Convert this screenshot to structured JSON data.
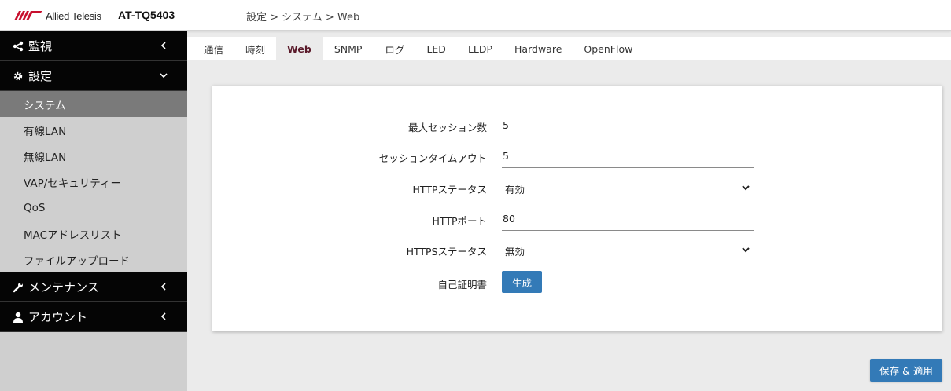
{
  "header": {
    "brand": "Allied Telesis",
    "model": "AT-TQ5403",
    "breadcrumb": "設定 > システム > Web"
  },
  "sidebar": {
    "groups": [
      {
        "label": "監視",
        "icon": "share-icon",
        "state": "collapsed"
      },
      {
        "label": "設定",
        "icon": "gear-icon",
        "state": "expanded"
      },
      {
        "label": "メンテナンス",
        "icon": "wrench-icon",
        "state": "collapsed"
      },
      {
        "label": "アカウント",
        "icon": "user-icon",
        "state": "collapsed"
      }
    ],
    "items": [
      {
        "label": "システム",
        "active": true
      },
      {
        "label": "有線LAN"
      },
      {
        "label": "無線LAN"
      },
      {
        "label": "VAP/セキュリティー"
      },
      {
        "label": "QoS"
      },
      {
        "label": "MACアドレスリスト"
      },
      {
        "label": "ファイルアップロード"
      }
    ]
  },
  "tabs": [
    {
      "label": "通信"
    },
    {
      "label": "時刻"
    },
    {
      "label": "Web",
      "active": true
    },
    {
      "label": "SNMP"
    },
    {
      "label": "ログ"
    },
    {
      "label": "LED"
    },
    {
      "label": "LLDP"
    },
    {
      "label": "Hardware"
    },
    {
      "label": "OpenFlow"
    }
  ],
  "form": {
    "max_sessions": {
      "label": "最大セッション数",
      "value": "5"
    },
    "session_timeout": {
      "label": "セッションタイムアウト",
      "value": "5"
    },
    "http_status": {
      "label": "HTTPステータス",
      "value": "有効"
    },
    "http_port": {
      "label": "HTTPポート",
      "value": "80"
    },
    "https_status": {
      "label": "HTTPSステータス",
      "value": "無効"
    },
    "self_cert": {
      "label": "自己証明書",
      "button": "生成"
    }
  },
  "actions": {
    "save_label": "保存 & 適用"
  },
  "colors": {
    "accent": "#337ab7",
    "nav_dark": "#050505",
    "active_tab": "#5a1a2a"
  }
}
